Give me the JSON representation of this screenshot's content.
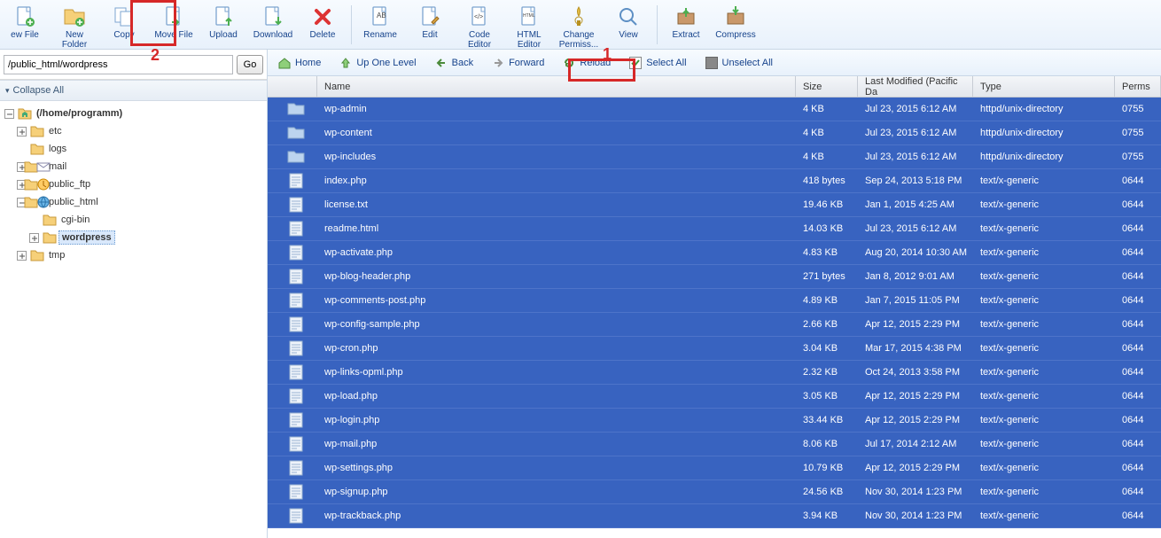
{
  "toolbar": [
    {
      "id": "new-file",
      "label": "ew File"
    },
    {
      "id": "new-folder",
      "label": "New\nFolder"
    },
    {
      "id": "copy",
      "label": "Copy"
    },
    {
      "id": "move-file",
      "label": "Move File"
    },
    {
      "id": "upload",
      "label": "Upload"
    },
    {
      "id": "download",
      "label": "Download"
    },
    {
      "id": "delete",
      "label": "Delete"
    },
    {
      "sep": true
    },
    {
      "id": "rename",
      "label": "Rename"
    },
    {
      "id": "edit",
      "label": "Edit"
    },
    {
      "id": "code-editor",
      "label": "Code\nEditor"
    },
    {
      "id": "html-editor",
      "label": "HTML\nEditor"
    },
    {
      "id": "change-perms",
      "label": "Change\nPermiss..."
    },
    {
      "id": "view",
      "label": "View"
    },
    {
      "sep": true
    },
    {
      "id": "extract",
      "label": "Extract"
    },
    {
      "id": "compress",
      "label": "Compress"
    }
  ],
  "path": {
    "value": "/public_html/wordpress",
    "go": "Go"
  },
  "collapse_all": "Collapse All",
  "tree": [
    {
      "depth": 0,
      "toggle": "minus",
      "icon": "home-folder",
      "label": "(/home/programm)",
      "bold": true
    },
    {
      "depth": 1,
      "toggle": "plus",
      "icon": "folder",
      "label": "etc"
    },
    {
      "depth": 1,
      "toggle": "none",
      "icon": "folder",
      "label": "logs"
    },
    {
      "depth": 1,
      "toggle": "plus",
      "icon": "mail-folder",
      "label": "mail"
    },
    {
      "depth": 1,
      "toggle": "plus",
      "icon": "ftp-folder",
      "label": "public_ftp"
    },
    {
      "depth": 1,
      "toggle": "minus",
      "icon": "web-folder",
      "label": "public_html"
    },
    {
      "depth": 2,
      "toggle": "none",
      "icon": "folder",
      "label": "cgi-bin"
    },
    {
      "depth": 2,
      "toggle": "plus",
      "icon": "folder",
      "label": "wordpress",
      "bold": true,
      "selected": true
    },
    {
      "depth": 1,
      "toggle": "plus",
      "icon": "folder",
      "label": "tmp"
    }
  ],
  "nav": [
    {
      "id": "home",
      "label": "Home",
      "icon": "home"
    },
    {
      "id": "up",
      "label": "Up One Level",
      "icon": "up"
    },
    {
      "id": "back",
      "label": "Back",
      "icon": "back"
    },
    {
      "id": "forward",
      "label": "Forward",
      "icon": "fwd"
    },
    {
      "id": "reload",
      "label": "Reload",
      "icon": "reload"
    },
    {
      "id": "select-all",
      "label": "Select All",
      "icon": "check"
    },
    {
      "id": "unselect-all",
      "label": "Unselect All",
      "icon": "uncheck"
    }
  ],
  "columns": {
    "name": "Name",
    "size": "Size",
    "modified": "Last Modified (Pacific Da",
    "type": "Type",
    "perms": "Perms"
  },
  "files": [
    {
      "name": "wp-admin",
      "size": "4 KB",
      "mod": "Jul 23, 2015 6:12 AM",
      "type": "httpd/unix-directory",
      "perms": "0755",
      "kind": "dir"
    },
    {
      "name": "wp-content",
      "size": "4 KB",
      "mod": "Jul 23, 2015 6:12 AM",
      "type": "httpd/unix-directory",
      "perms": "0755",
      "kind": "dir"
    },
    {
      "name": "wp-includes",
      "size": "4 KB",
      "mod": "Jul 23, 2015 6:12 AM",
      "type": "httpd/unix-directory",
      "perms": "0755",
      "kind": "dir"
    },
    {
      "name": "index.php",
      "size": "418 bytes",
      "mod": "Sep 24, 2013 5:18 PM",
      "type": "text/x-generic",
      "perms": "0644",
      "kind": "file"
    },
    {
      "name": "license.txt",
      "size": "19.46 KB",
      "mod": "Jan 1, 2015 4:25 AM",
      "type": "text/x-generic",
      "perms": "0644",
      "kind": "file"
    },
    {
      "name": "readme.html",
      "size": "14.03 KB",
      "mod": "Jul 23, 2015 6:12 AM",
      "type": "text/x-generic",
      "perms": "0644",
      "kind": "file"
    },
    {
      "name": "wp-activate.php",
      "size": "4.83 KB",
      "mod": "Aug 20, 2014 10:30 AM",
      "type": "text/x-generic",
      "perms": "0644",
      "kind": "file"
    },
    {
      "name": "wp-blog-header.php",
      "size": "271 bytes",
      "mod": "Jan 8, 2012 9:01 AM",
      "type": "text/x-generic",
      "perms": "0644",
      "kind": "file"
    },
    {
      "name": "wp-comments-post.php",
      "size": "4.89 KB",
      "mod": "Jan 7, 2015 11:05 PM",
      "type": "text/x-generic",
      "perms": "0644",
      "kind": "file"
    },
    {
      "name": "wp-config-sample.php",
      "size": "2.66 KB",
      "mod": "Apr 12, 2015 2:29 PM",
      "type": "text/x-generic",
      "perms": "0644",
      "kind": "file"
    },
    {
      "name": "wp-cron.php",
      "size": "3.04 KB",
      "mod": "Mar 17, 2015 4:38 PM",
      "type": "text/x-generic",
      "perms": "0644",
      "kind": "file"
    },
    {
      "name": "wp-links-opml.php",
      "size": "2.32 KB",
      "mod": "Oct 24, 2013 3:58 PM",
      "type": "text/x-generic",
      "perms": "0644",
      "kind": "file"
    },
    {
      "name": "wp-load.php",
      "size": "3.05 KB",
      "mod": "Apr 12, 2015 2:29 PM",
      "type": "text/x-generic",
      "perms": "0644",
      "kind": "file"
    },
    {
      "name": "wp-login.php",
      "size": "33.44 KB",
      "mod": "Apr 12, 2015 2:29 PM",
      "type": "text/x-generic",
      "perms": "0644",
      "kind": "file"
    },
    {
      "name": "wp-mail.php",
      "size": "8.06 KB",
      "mod": "Jul 17, 2014 2:12 AM",
      "type": "text/x-generic",
      "perms": "0644",
      "kind": "file"
    },
    {
      "name": "wp-settings.php",
      "size": "10.79 KB",
      "mod": "Apr 12, 2015 2:29 PM",
      "type": "text/x-generic",
      "perms": "0644",
      "kind": "file"
    },
    {
      "name": "wp-signup.php",
      "size": "24.56 KB",
      "mod": "Nov 30, 2014 1:23 PM",
      "type": "text/x-generic",
      "perms": "0644",
      "kind": "file"
    },
    {
      "name": "wp-trackback.php",
      "size": "3.94 KB",
      "mod": "Nov 30, 2014 1:23 PM",
      "type": "text/x-generic",
      "perms": "0644",
      "kind": "file"
    }
  ],
  "annotations": {
    "num1": "1",
    "num2": "2"
  }
}
